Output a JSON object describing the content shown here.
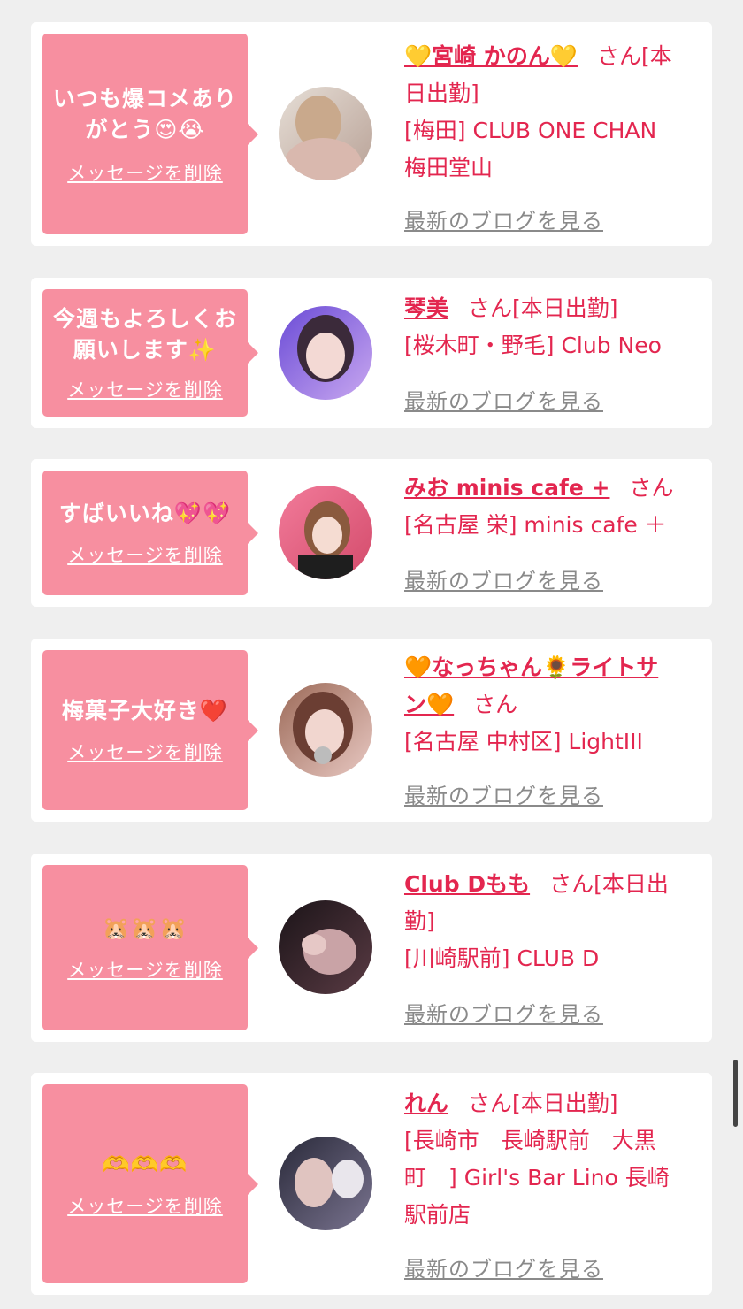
{
  "delete_label": "メッセージを削除",
  "blog_label": "最新のブログを見る",
  "colors": {
    "accent": "#e3264f",
    "bubble": "#f78fa0",
    "background": "#efefef"
  },
  "cards": [
    {
      "message_line1": "いつも爆コメあり",
      "message_line2": "がとう😍😭",
      "name": "💛宮崎 かのん💛",
      "san": "さん[本",
      "status": "日出勤]",
      "shop_line1": "[梅田] CLUB ONE CHAN",
      "shop_line2": "梅田堂山"
    },
    {
      "message_line1": "今週もよろしくお",
      "message_line2": "願いします✨",
      "name": "琴美",
      "san": "さん[本日出勤]",
      "shop_line1": "[桜木町・野毛] Club Neo"
    },
    {
      "message_line1": "すばいいね💖💖",
      "name": "みお minis cafe +",
      "san": "さん",
      "shop_line1": "[名古屋 栄] minis cafe ＋"
    },
    {
      "message_line1": "梅菓子大好き❤️",
      "name_line1": "🧡なっちゃん🌻ライトサ",
      "name_line2": "ン🧡",
      "san": "さん",
      "shop_line1": "[名古屋 中村区] LightIII"
    },
    {
      "message_line1": "🐹🐹🐹",
      "name": "Club Dもも",
      "san": "さん[本日出",
      "status": "勤]",
      "shop_line1": "[川崎駅前] CLUB D"
    },
    {
      "message_line1": "🫶🫶🫶",
      "name": "れん",
      "san": "さん[本日出勤]",
      "shop_line1": "[長崎市　長崎駅前　大黒",
      "shop_line2": "町　] Girl's Bar Lino 長崎",
      "shop_line3": "駅前店"
    }
  ]
}
